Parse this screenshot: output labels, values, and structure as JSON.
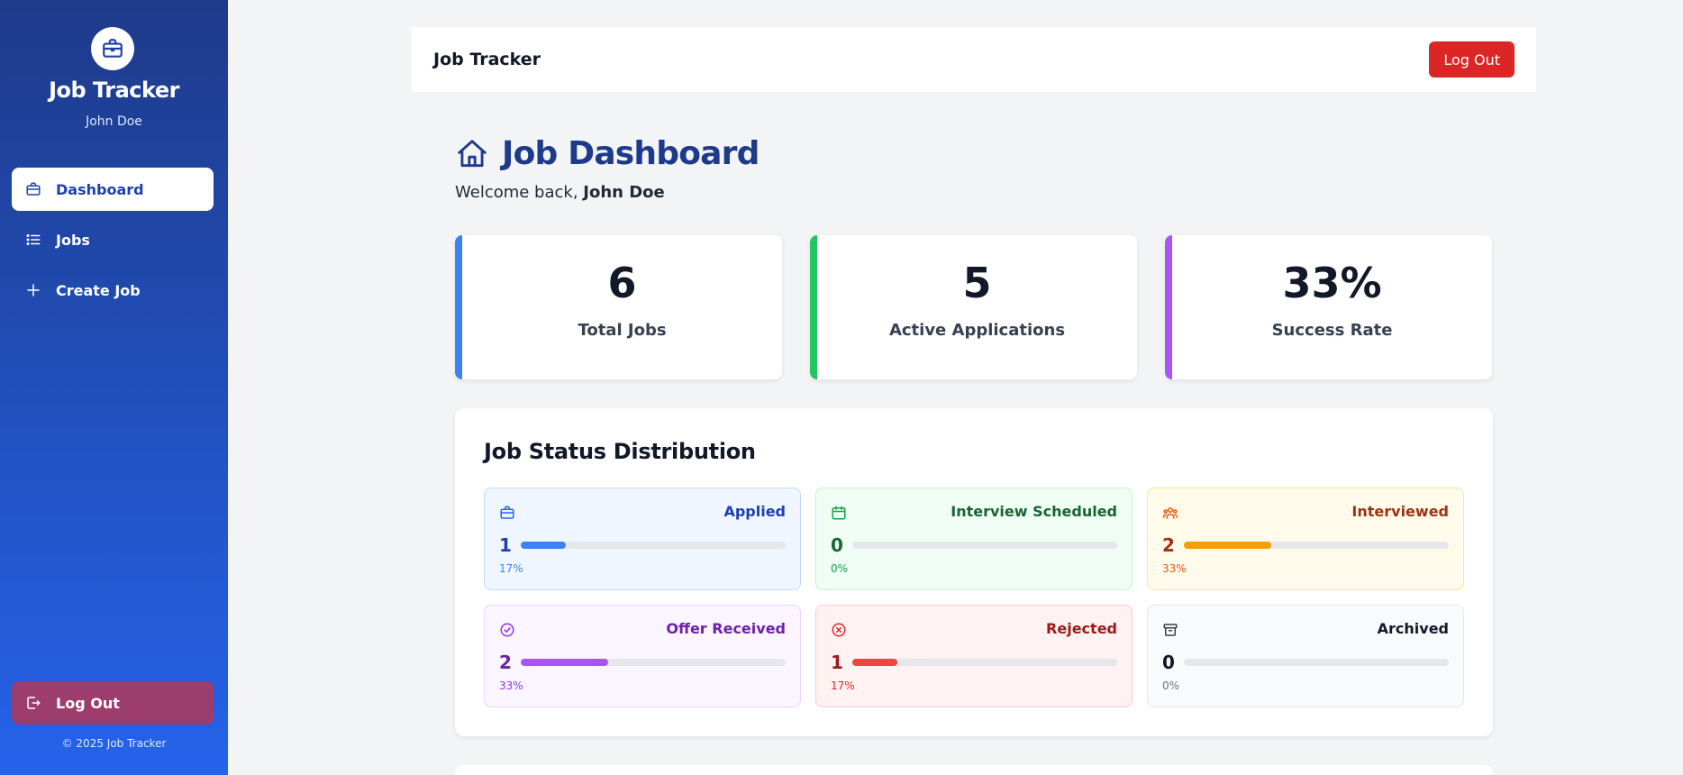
{
  "sidebar": {
    "brand": "Job Tracker",
    "user": "John Doe",
    "items": [
      {
        "label": "Dashboard",
        "icon": "briefcase-icon",
        "active": true
      },
      {
        "label": "Jobs",
        "icon": "list-icon",
        "active": false
      },
      {
        "label": "Create Job",
        "icon": "plus-icon",
        "active": false
      }
    ],
    "logout_label": "Log Out",
    "copyright": "© 2025 Job Tracker"
  },
  "topbar": {
    "title": "Job Tracker",
    "logout_label": "Log Out"
  },
  "page": {
    "title": "Job Dashboard",
    "welcome_prefix": "Welcome back, ",
    "welcome_name": "John Doe"
  },
  "stats": [
    {
      "value": "6",
      "label": "Total Jobs",
      "color": "#3b82f6"
    },
    {
      "value": "5",
      "label": "Active Applications",
      "color": "#22c55e"
    },
    {
      "value": "33%",
      "label": "Success Rate",
      "color": "#a855f7"
    }
  ],
  "distribution": {
    "title": "Job Status Distribution",
    "statuses": [
      {
        "label": "Applied",
        "count": "1",
        "percent": "17%",
        "fraction": 0.17,
        "icon": "briefcase-icon",
        "color": "#1e40af",
        "bar": "#3b82f6"
      },
      {
        "label": "Interview Scheduled",
        "count": "0",
        "percent": "0%",
        "fraction": 0,
        "icon": "calendar-icon",
        "color": "#166534",
        "bar": "#22c55e"
      },
      {
        "label": "Interviewed",
        "count": "2",
        "percent": "33%",
        "fraction": 0.33,
        "icon": "users-icon",
        "color": "#9a3412",
        "bar": "#f59e0b"
      },
      {
        "label": "Offer Received",
        "count": "2",
        "percent": "33%",
        "fraction": 0.33,
        "icon": "check-circle-icon",
        "color": "#6b21a8",
        "bar": "#a855f7"
      },
      {
        "label": "Rejected",
        "count": "1",
        "percent": "17%",
        "fraction": 0.17,
        "icon": "x-circle-icon",
        "color": "#991b1b",
        "bar": "#ef4444"
      },
      {
        "label": "Archived",
        "count": "0",
        "percent": "0%",
        "fraction": 0,
        "icon": "archive-icon",
        "color": "#111827",
        "bar": "#6b7280"
      }
    ]
  }
}
